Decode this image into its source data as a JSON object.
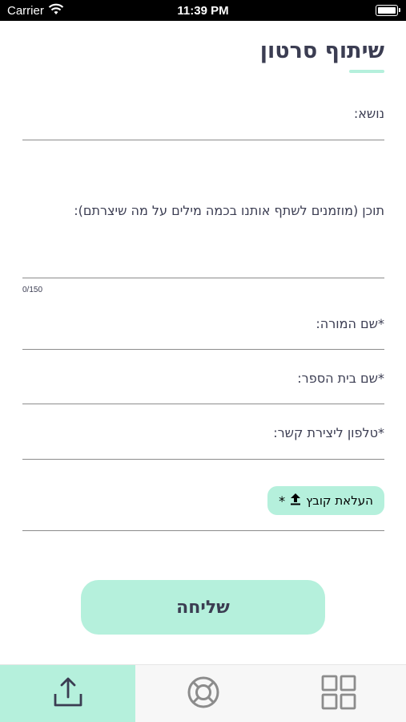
{
  "status_bar": {
    "carrier": "Carrier",
    "time": "11:39 PM"
  },
  "header": {
    "title": "שיתוף סרטון"
  },
  "form": {
    "subject_label": "נושא:",
    "content_label": "תוכן (מוזמנים לשתף אותנו בכמה מילים על מה שיצרתם):",
    "char_counter": "0/150",
    "teacher_label": "*שם המורה:",
    "school_label": "*שם בית הספר:",
    "phone_label": "*טלפון ליצירת קשר:",
    "upload_label": "העלאת קובץ",
    "upload_required": "*",
    "submit_label": "שליחה"
  },
  "tabbar": {
    "tabs": [
      {
        "icon": "upload-icon",
        "active": true
      },
      {
        "icon": "lifebuoy-icon",
        "active": false
      },
      {
        "icon": "grid-icon",
        "active": false
      }
    ]
  },
  "colors": {
    "accent": "#b5f0dc",
    "text": "#3b3d52",
    "divider": "#8c8c8c"
  }
}
